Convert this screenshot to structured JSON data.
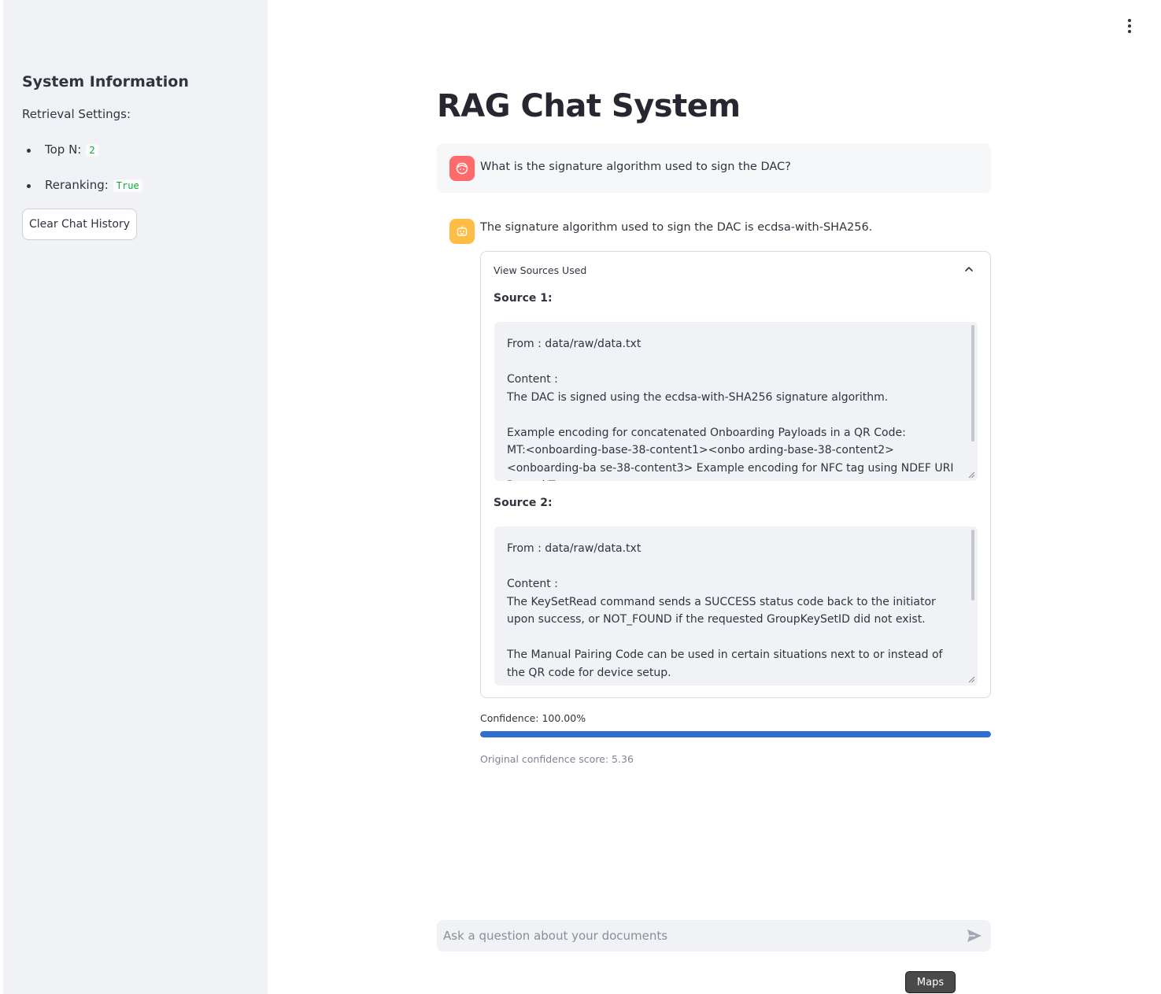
{
  "sidebar": {
    "title": "System Information",
    "subtitle": "Retrieval Settings:",
    "items": [
      {
        "label": "Top N:",
        "value": "2"
      },
      {
        "label": "Reranking:",
        "value": "True"
      }
    ],
    "clear_button": "Clear Chat History"
  },
  "header": {
    "title": "RAG Chat System",
    "menu_icon": "kebab-menu-icon"
  },
  "chat": {
    "user_message": "What is the signature algorithm used to sign the DAC?",
    "assistant_message": "The signature algorithm used to sign the DAC is ecdsa-with-SHA256.",
    "expander": {
      "label": "View Sources Used",
      "sources": [
        {
          "label": "Source 1:",
          "content": "From : data/raw/data.txt\n\nContent :\nThe DAC is signed using the ecdsa-with-SHA256 signature algorithm.\n\nExample encoding for concatenated Onboarding Payloads in a QR Code:\nMT:<onboarding-base-38-content1><onbo arding-base-38-content2><onboarding-ba se-38-content3> Example encoding for NFC tag using NDEF URI Record Type"
        },
        {
          "label": "Source 2:",
          "content": "From : data/raw/data.txt\n\nContent :\nThe KeySetRead command sends a SUCCESS status code back to the initiator upon success, or NOT_FOUND if the requested GroupKeySetID did not exist.\n\nThe Manual Pairing Code can be used in certain situations next to or instead of the QR code for device setup."
        }
      ]
    },
    "confidence_label": "Confidence: 100.00%",
    "confidence_value": 1.0,
    "original_score": "Original confidence score: 5.36"
  },
  "input": {
    "placeholder": "Ask a question about your documents"
  },
  "tooltip": {
    "label": "Maps"
  },
  "colors": {
    "sidebar_bg": "#f0f2f6",
    "user_avatar": "#ff6b6b",
    "assistant_avatar": "#ffbd45",
    "progress": "#2e6fd1",
    "code_green": "#09ab3b"
  }
}
